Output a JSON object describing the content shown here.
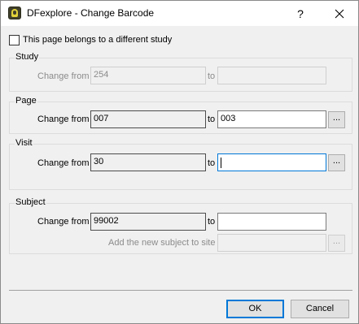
{
  "window": {
    "title": "DFexplore - Change Barcode",
    "help_glyph": "?",
    "icons": {
      "app": "dfexplore-app-icon",
      "close": "close-icon"
    }
  },
  "different_study": {
    "label": "This page belongs to a different study",
    "checked": false
  },
  "study": {
    "title": "Study",
    "change_from_label": "Change from",
    "from_value": "254",
    "to_label": "to",
    "to_value": "",
    "enabled": false
  },
  "page": {
    "title": "Page",
    "change_from_label": "Change from",
    "from_value": "007",
    "to_label": "to",
    "to_value": "003",
    "browse_label": "..."
  },
  "visit": {
    "title": "Visit",
    "change_from_label": "Change from",
    "from_value": "30",
    "to_label": "to",
    "to_value": "",
    "browse_label": "..."
  },
  "subject": {
    "title": "Subject",
    "change_from_label": "Change from",
    "from_value": "99002",
    "to_label": "to",
    "to_value": "",
    "add_site_label": "Add the new subject to site",
    "site_value": "",
    "browse_label": "..."
  },
  "buttons": {
    "ok": "OK",
    "cancel": "Cancel"
  },
  "colors": {
    "focus": "#0078d7",
    "background": "#f0f0f0",
    "disabled_text": "#8b8b8b"
  }
}
